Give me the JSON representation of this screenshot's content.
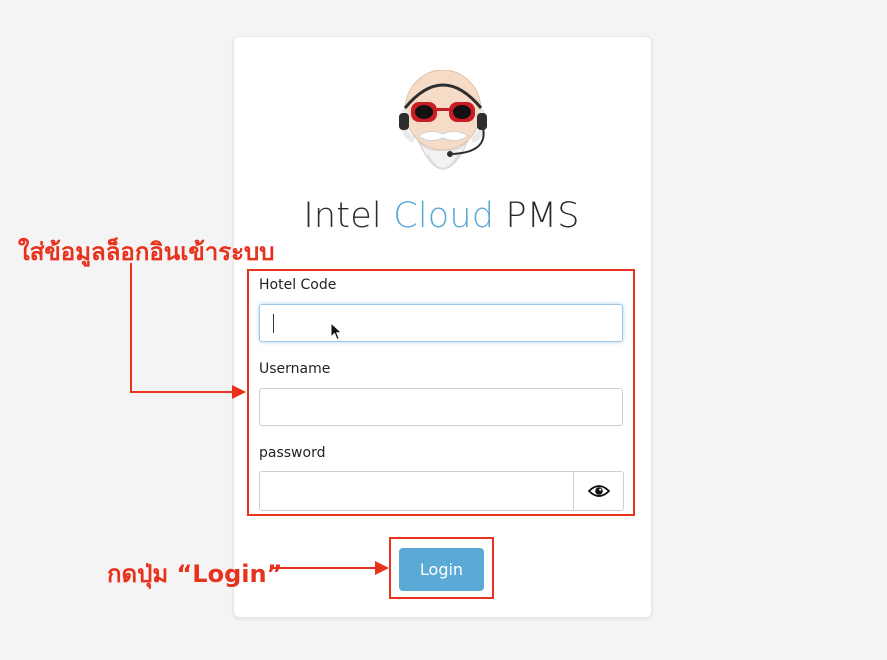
{
  "title": {
    "part1": "Intel ",
    "part2": "Cloud",
    "part3": " PMS"
  },
  "form": {
    "hotel_code_label": "Hotel Code",
    "username_label": "Username",
    "password_label": "password",
    "login_label": "Login"
  },
  "annotations": {
    "fill_info": "ใส่ข้อมูลล็อกอินเข้าระบบ",
    "press_login": "กดปุ่ม “Login”"
  },
  "colors": {
    "accent": "#5aaad5",
    "annotation": "#e8321e"
  },
  "icons": [
    "mascot-logo",
    "eye-icon",
    "mouse-pointer-icon"
  ]
}
